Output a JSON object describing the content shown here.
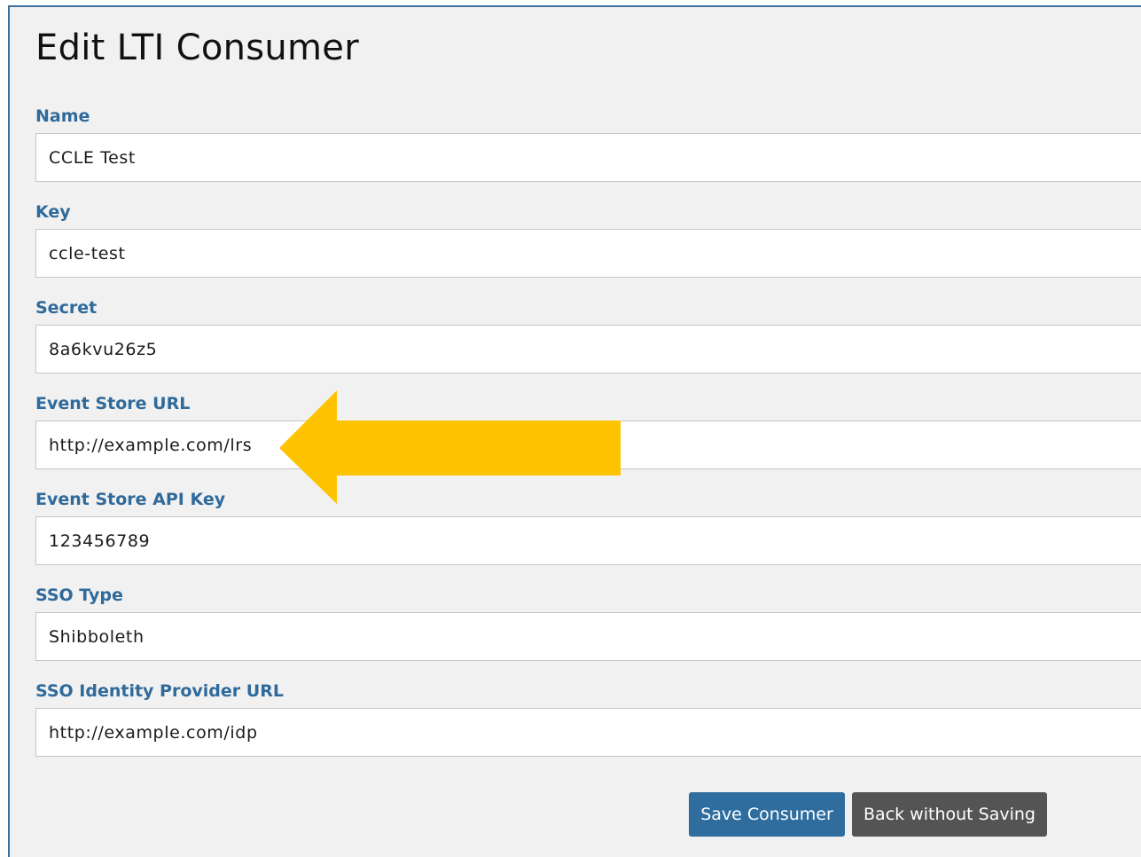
{
  "page": {
    "title": "Edit LTI Consumer"
  },
  "form": {
    "fields": [
      {
        "label": "Name",
        "value": "CCLE Test"
      },
      {
        "label": "Key",
        "value": "ccle-test"
      },
      {
        "label": "Secret",
        "value": "8a6kvu26z5"
      },
      {
        "label": "Event Store URL",
        "value": "http://example.com/lrs"
      },
      {
        "label": "Event Store API Key",
        "value": "123456789"
      },
      {
        "label": "SSO Type",
        "value": "Shibboleth"
      },
      {
        "label": "SSO Identity Provider URL",
        "value": "http://example.com/idp"
      }
    ]
  },
  "actions": {
    "save_label": "Save Consumer",
    "back_label": "Back without Saving"
  },
  "colors": {
    "label": "#2f6a9b",
    "save_button": "#2e6d9e",
    "back_button": "#545454",
    "highlight_arrow": "#fdc300",
    "panel_background": "#f1f1f1"
  },
  "annotation": {
    "icon": "left-arrow-icon",
    "points_to": "Event Store URL"
  }
}
